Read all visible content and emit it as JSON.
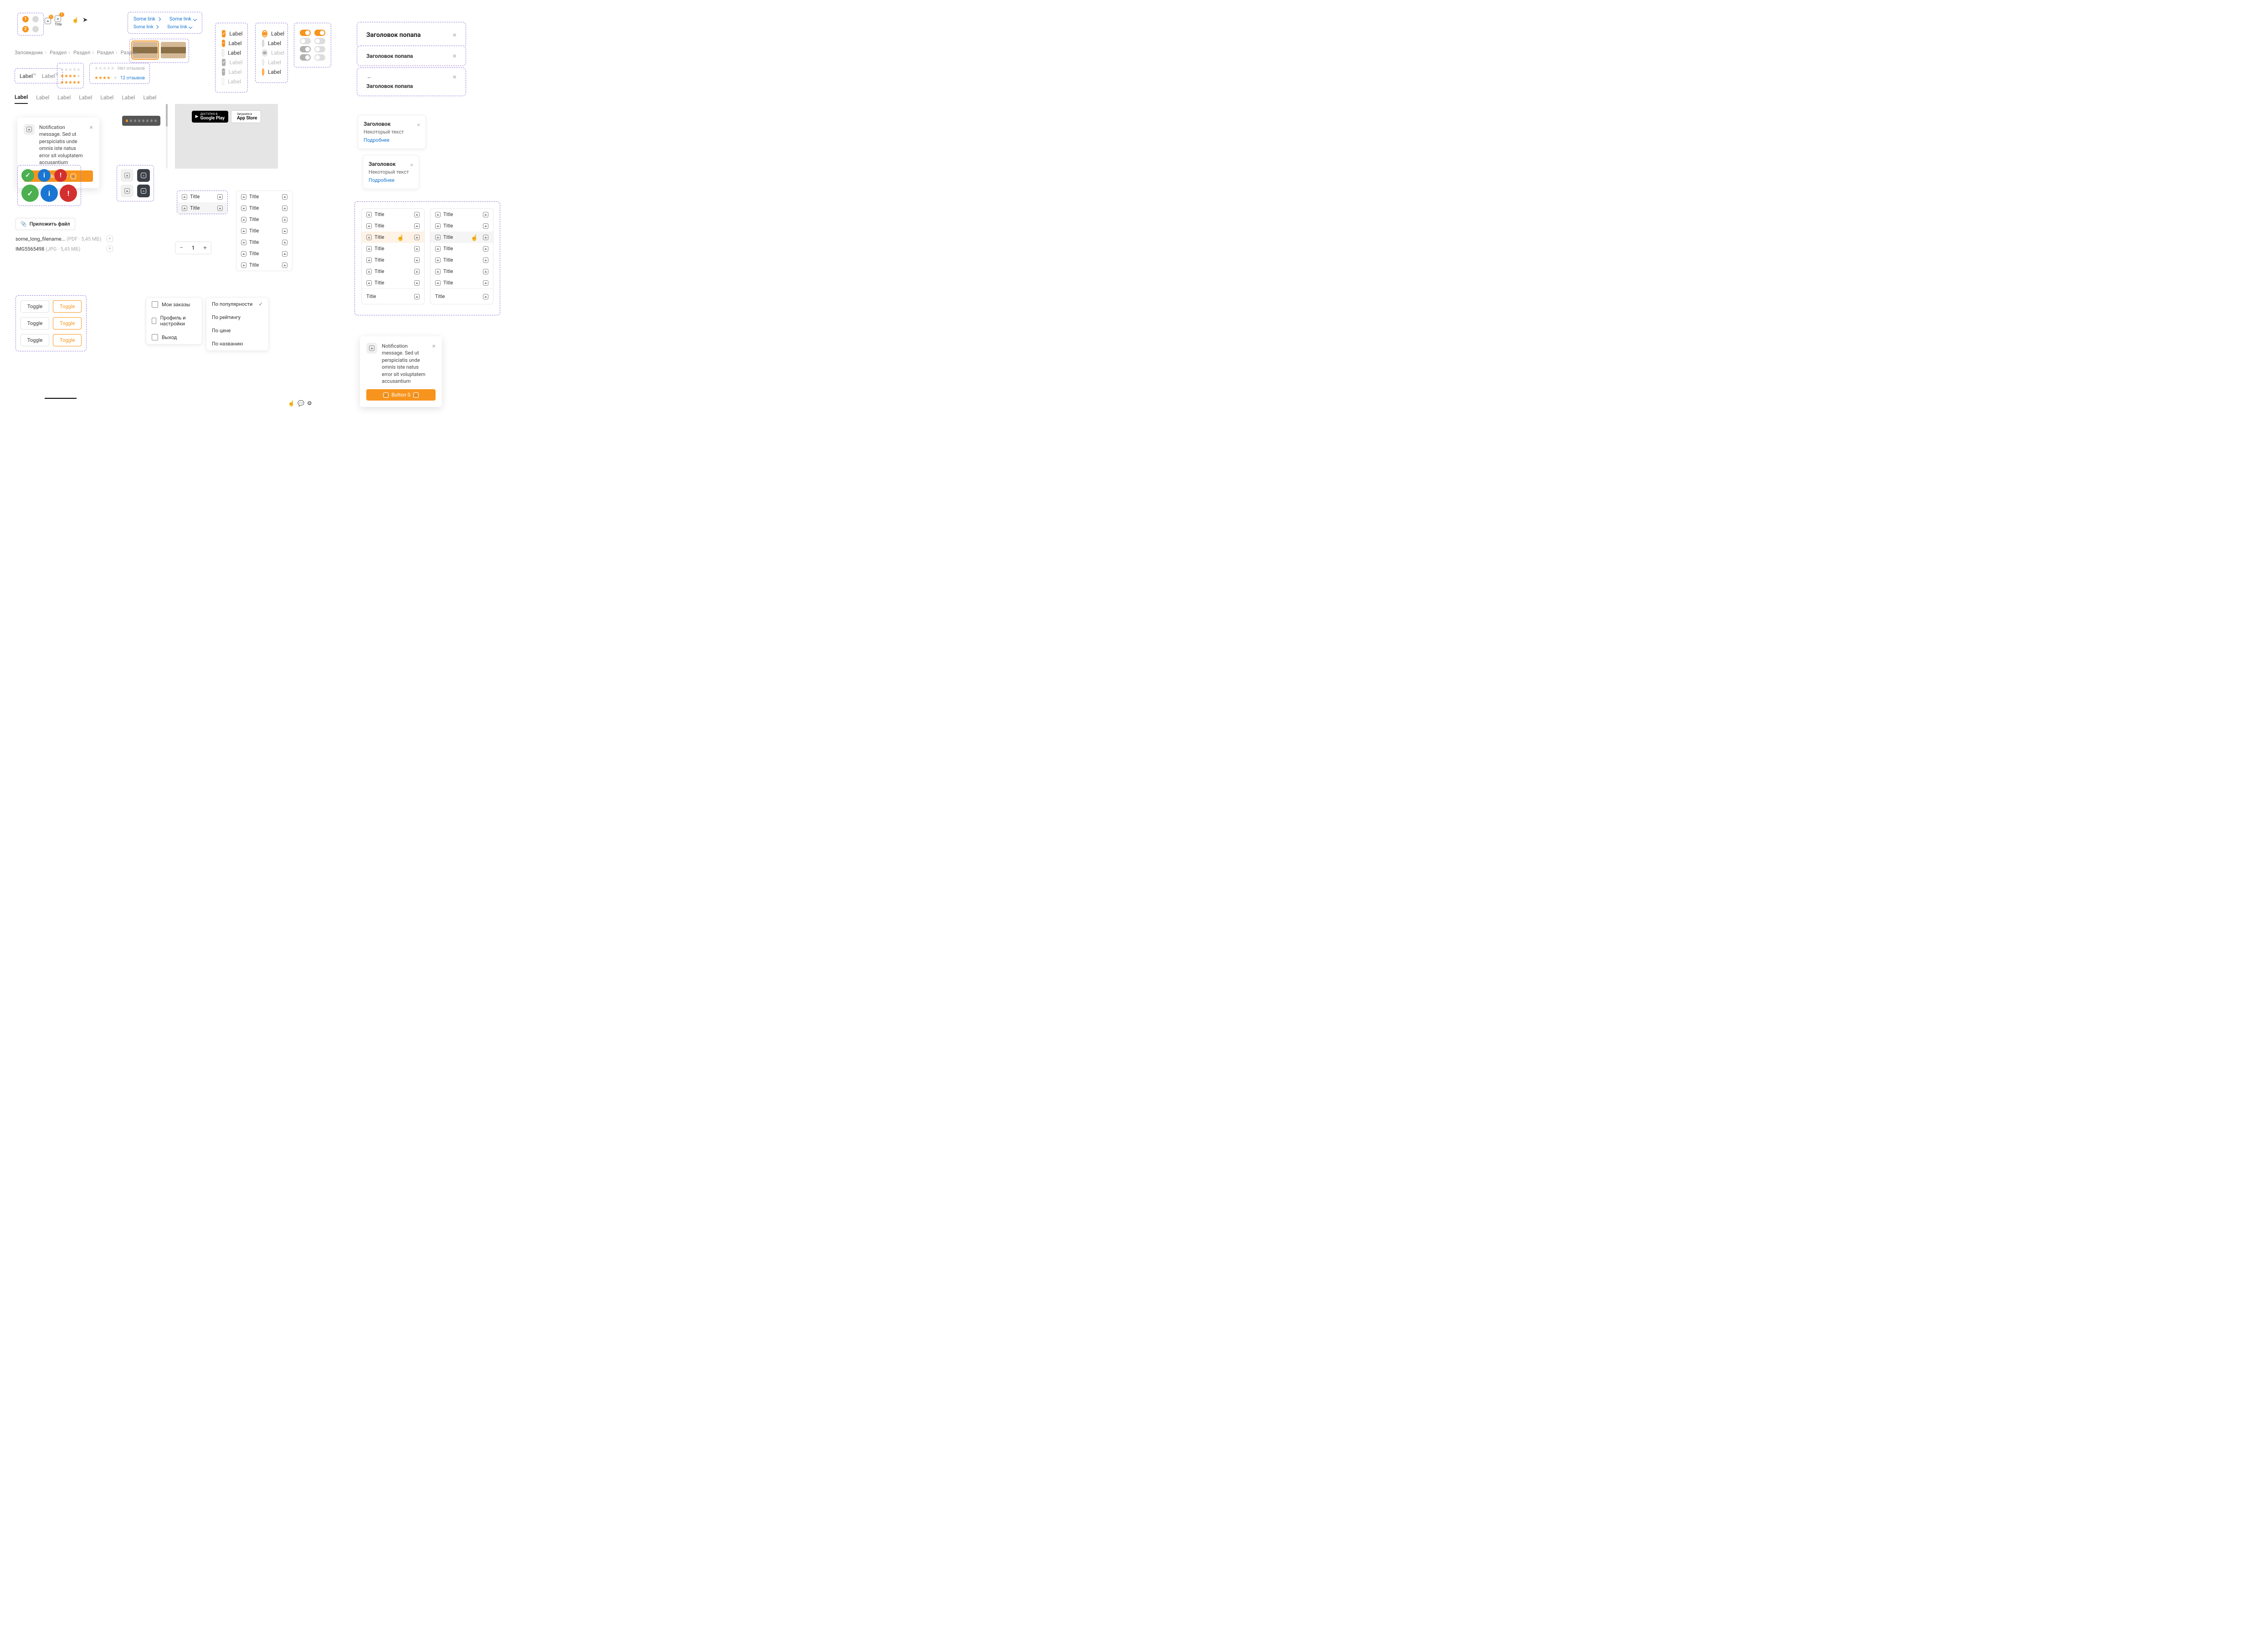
{
  "steps": {
    "s1": "1",
    "s2": "2"
  },
  "titleLabel": "Title",
  "links": {
    "a": "Some link",
    "b": "Some link",
    "c": "Some link",
    "d": "Some link"
  },
  "crumbs": [
    "Заповедник",
    "Раздел",
    "Раздел",
    "Раздел",
    "Раздел"
  ],
  "labels": {
    "a": "Label",
    "b": "Label"
  },
  "reviews": {
    "none": "Нет отзывов",
    "count": "12 отзывов"
  },
  "tabs": [
    "Label",
    "Label",
    "Label",
    "Label",
    "Label",
    "Label",
    "Label"
  ],
  "checks": [
    "Label",
    "Label",
    "Label",
    "Label",
    "Label",
    "Label"
  ],
  "radios": [
    "Label",
    "Label",
    "Label",
    "Label",
    "Label"
  ],
  "popup1": "Заголовок попапа",
  "popup2": "Заголовок попапа",
  "popup3": "Заголовок попапа",
  "notif": {
    "msg": "Notification message. Sed ut perspiciatis unde omnis iste natus error sit voluptatem accusantium",
    "btn": "Button S"
  },
  "tooltip": {
    "title": "Заголовок",
    "text": "Некоторый текст",
    "link": "Подробнее"
  },
  "attach": "Приложить файл",
  "files": {
    "f1name": "some_long_filename...",
    "f1meta": "(PDF · 5,45 МБ)",
    "f2name": "IMG5565498",
    "f2meta": "(JPG · 5,45 МБ)"
  },
  "stepval": "1",
  "listTitle": "Title",
  "toggle": "Toggle",
  "userMenu": {
    "orders": "Мои заказы",
    "profile": "Профиль и настройки",
    "exit": "Выход"
  },
  "sortMenu": {
    "pop": "По популярности",
    "rating": "По рейтингу",
    "price": "По цене",
    "name": "По названию"
  },
  "store": {
    "gp1": "ДОСТУПНО В",
    "gp2": "Google Play",
    "as1": "Загрузите в",
    "as2": "App Store"
  }
}
